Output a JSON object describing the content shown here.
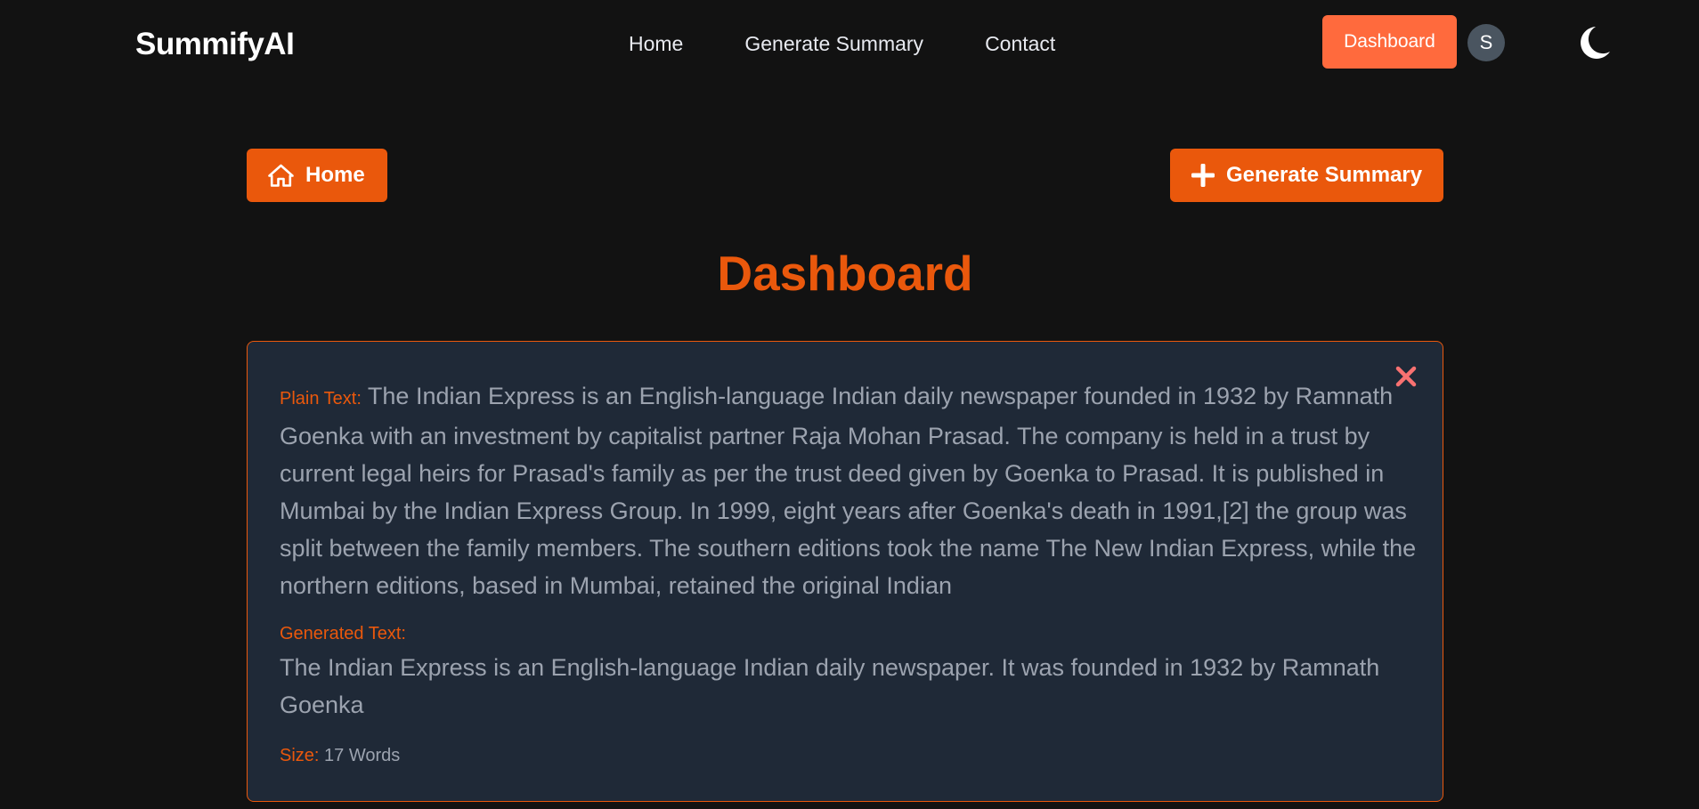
{
  "navbar": {
    "brand": "SummifyAI",
    "links": [
      "Home",
      "Generate Summary",
      "Contact"
    ],
    "dashboard_button": "Dashboard",
    "avatar_initial": "S",
    "theme_icon": "moon-icon"
  },
  "actions": {
    "home_label": "Home",
    "home_icon": "home-icon",
    "generate_label": "Generate Summary",
    "generate_icon": "plus-icon"
  },
  "page": {
    "title": "Dashboard"
  },
  "summary_card": {
    "close_icon": "close-icon",
    "plain_label": "Plain Text:",
    "plain_text": "The Indian Express is an English-language Indian daily newspaper founded in 1932 by Ramnath Goenka with an investment by capitalist partner Raja Mohan Prasad. The company is held in a trust by current legal heirs for Prasad's family as per the trust deed given by Goenka to Prasad. It is published in Mumbai by the Indian Express Group. In 1999, eight years after Goenka's death in 1991,[2] the group was split between the family members. The southern editions took the name The New Indian Express, while the northern editions, based in Mumbai, retained the original Indian",
    "generated_label": "Generated Text:",
    "generated_text": "The Indian Express is an English-language Indian daily newspaper. It was founded in 1932 by Ramnath Goenka",
    "size_label": "Size:",
    "size_value": "17 Words"
  },
  "colors": {
    "background": "#121212",
    "accent": "#ea580c",
    "dashboard_button": "#ff6a3d",
    "card_background": "#1f2937",
    "muted_text": "#9ca3af",
    "close_icon": "#f87171"
  }
}
